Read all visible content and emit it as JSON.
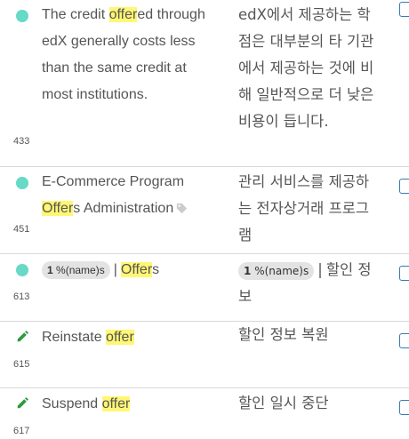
{
  "rows": [
    {
      "number": "433",
      "status_icon": "status-dot-icon",
      "source_parts": [
        "The credit ",
        "offer",
        "ed through edX generally costs less than the same credit at most institutions."
      ],
      "target": "edX에서 제공하는 학점은 대부분의 타 기관에서 제공하는 것에 비해 일반적으로 더 낮은 비용이 듭니다."
    },
    {
      "number": "451",
      "status_icon": "status-dot-icon",
      "source_parts": [
        "E-Commerce Program ",
        "Offer",
        "s Administration"
      ],
      "target": "관리 서비스를 제공하는 전자상거래 프로그램"
    },
    {
      "number": "613",
      "status_icon": "status-dot-icon",
      "placeholder_num": "1",
      "placeholder_text": "%(name)s",
      "separator": "|",
      "source_parts": [
        "",
        "Offer",
        "s"
      ],
      "target": "할인 정보"
    },
    {
      "number": "615",
      "status_icon": "pencil-icon",
      "source_parts": [
        "Reinstate ",
        "offer",
        ""
      ],
      "target": "할인 정보 복원"
    },
    {
      "number": "617",
      "status_icon": "pencil-icon",
      "source_parts": [
        "Suspend ",
        "offer",
        ""
      ],
      "target": "할인 일시 중단"
    }
  ],
  "colors": {
    "highlight": "#fff774",
    "dot": "#66d9c7",
    "pencil": "#2e9b3e",
    "checkbox": "#337ab7"
  }
}
